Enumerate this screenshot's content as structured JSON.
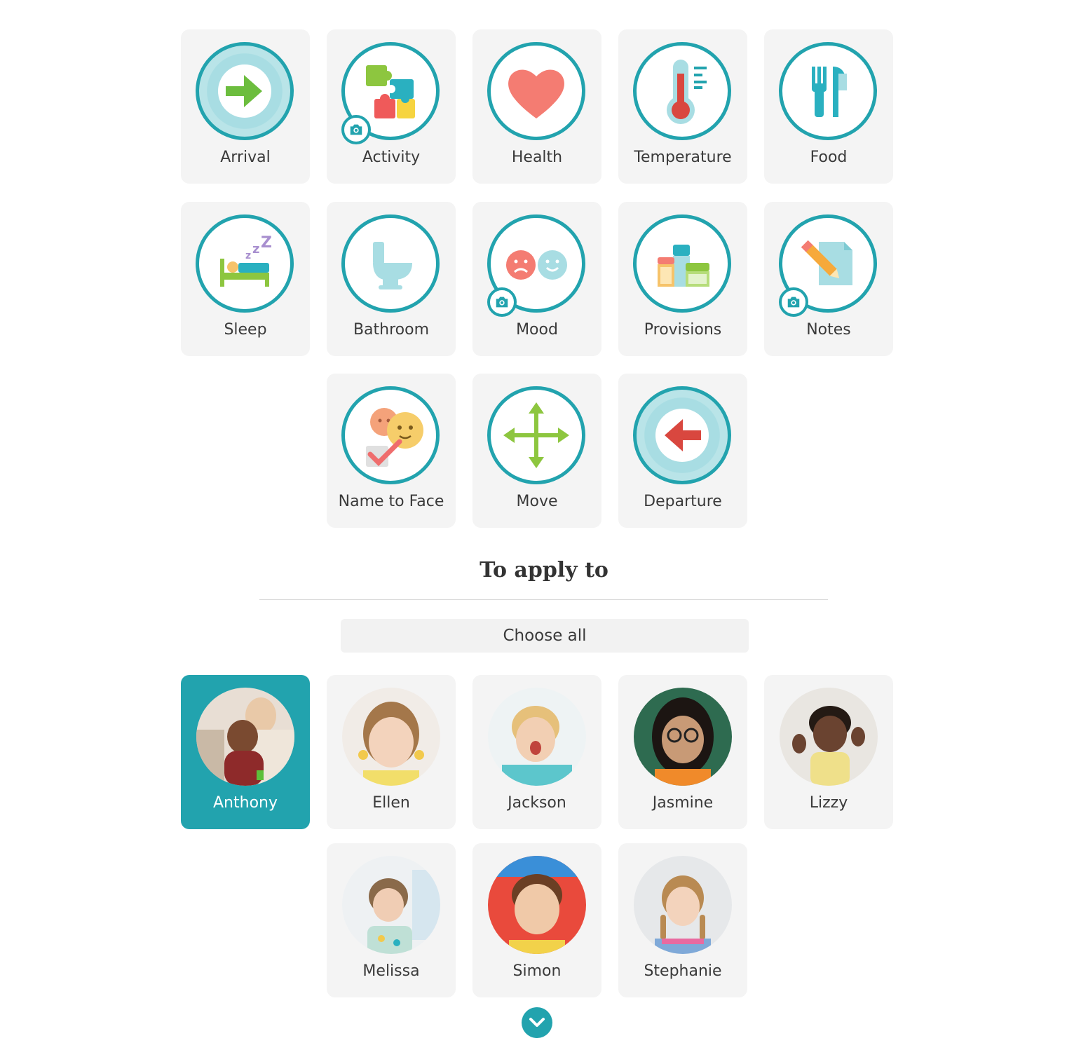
{
  "activities": [
    {
      "label": "Arrival"
    },
    {
      "label": "Activity"
    },
    {
      "label": "Health"
    },
    {
      "label": "Temperature"
    },
    {
      "label": "Food"
    },
    {
      "label": "Sleep"
    },
    {
      "label": "Bathroom"
    },
    {
      "label": "Mood"
    },
    {
      "label": "Provisions"
    },
    {
      "label": "Notes"
    },
    {
      "label": "Name to Face"
    },
    {
      "label": "Move"
    },
    {
      "label": "Departure"
    }
  ],
  "apply_section": {
    "title": "To apply to",
    "choose_all_label": "Choose all"
  },
  "children": [
    {
      "name": "Anthony",
      "selected": true
    },
    {
      "name": "Ellen",
      "selected": false
    },
    {
      "name": "Jackson",
      "selected": false
    },
    {
      "name": "Jasmine",
      "selected": false
    },
    {
      "name": "Lizzy",
      "selected": false
    },
    {
      "name": "Melissa",
      "selected": false
    },
    {
      "name": "Simon",
      "selected": false
    },
    {
      "name": "Stephanie",
      "selected": false
    }
  ],
  "colors": {
    "accent": "#22a3ae",
    "tile_background": "#f4f4f4"
  }
}
